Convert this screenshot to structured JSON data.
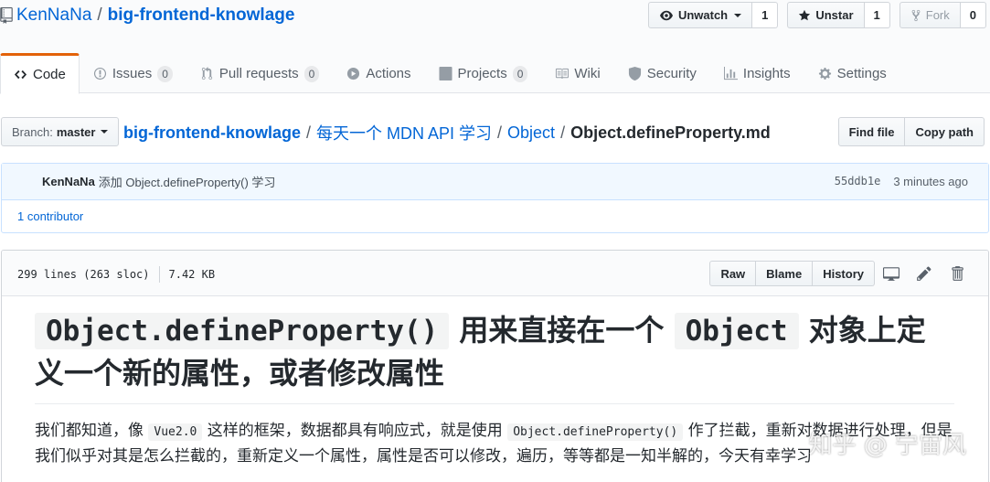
{
  "repo": {
    "owner": "KenNaNa",
    "separator": "/",
    "name": "big-frontend-knowlage"
  },
  "actions": {
    "watch": {
      "label": "Unwatch",
      "count": "1"
    },
    "star": {
      "label": "Unstar",
      "count": "1"
    },
    "fork": {
      "label": "Fork",
      "count": "0"
    }
  },
  "nav": {
    "code": "Code",
    "issues": "Issues",
    "issues_count": "0",
    "pulls": "Pull requests",
    "pulls_count": "0",
    "actions": "Actions",
    "projects": "Projects",
    "projects_count": "0",
    "wiki": "Wiki",
    "security": "Security",
    "insights": "Insights",
    "settings": "Settings"
  },
  "branch": {
    "label": "Branch:",
    "value": "master"
  },
  "breadcrumb": {
    "root": "big-frontend-knowlage",
    "sep": "/",
    "dir1": "每天一个 MDN API 学习",
    "dir2": "Object",
    "file": "Object.defineProperty.md"
  },
  "file_nav": {
    "find_file": "Find file",
    "copy_path": "Copy path"
  },
  "commit": {
    "author": "KenNaNa",
    "message": "添加 Object.defineProperty() 学习",
    "sha": "55ddb1e",
    "time": "3 minutes ago",
    "contributors": "1 contributor"
  },
  "file": {
    "lines": "299 lines (263 sloc)",
    "size": "7.42 KB",
    "raw": "Raw",
    "blame": "Blame",
    "history": "History"
  },
  "content": {
    "h1_code1": "Object.defineProperty()",
    "h1_text1": "用来直接在一个",
    "h1_code2": "Object",
    "h1_text2": "对象上定义一个新的属性，或者修改属性",
    "p_text1": "我们都知道，像",
    "p_code1": "Vue2.0",
    "p_text2": "这样的框架，数据都具有响应式，就是使用",
    "p_code2": "Object.defineProperty()",
    "p_text3": "作了拦截，重新对数据进行处理，但是我们似乎对其是怎么拦截的，重新定义一个属性，属性是否可以修改，遍历，等等都是一知半解的，今天有幸学习"
  },
  "watermark": "知乎 @ 宁宙风",
  "colors": {
    "link": "#0366d6",
    "selected_tab": "#e36209",
    "commit_bg": "#f1f8ff"
  }
}
